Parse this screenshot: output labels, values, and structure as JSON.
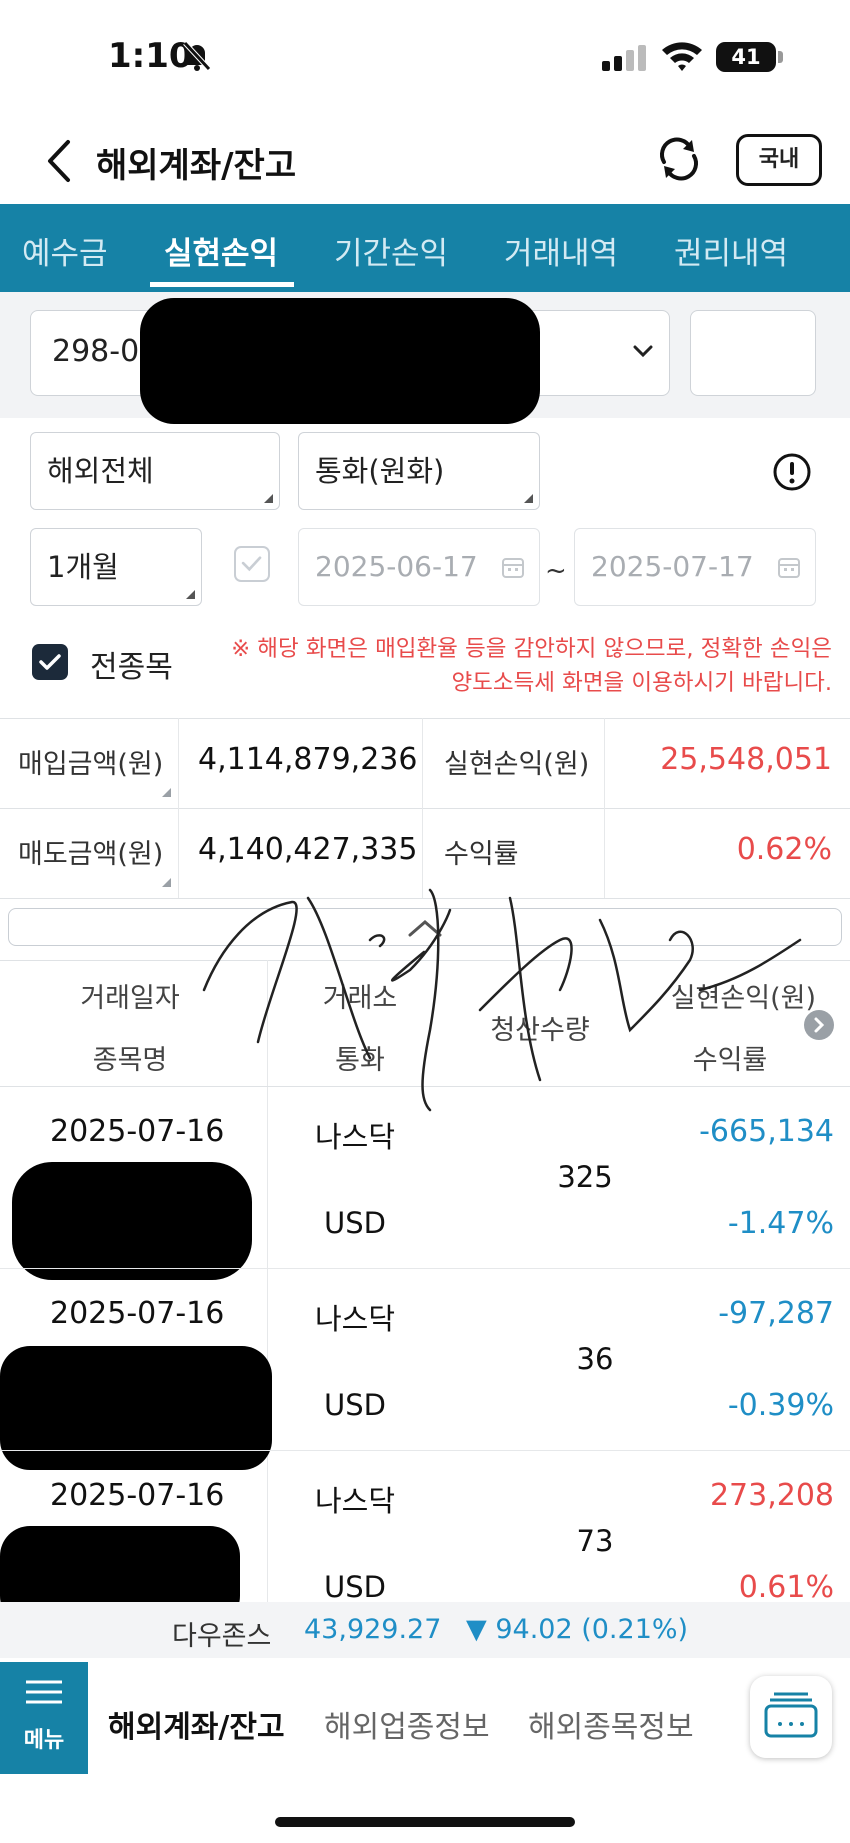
{
  "status": {
    "time": "1:10",
    "battery": "41"
  },
  "header": {
    "title": "해외계좌/잔고",
    "domestic_label": "국내"
  },
  "tabs": [
    "예수금",
    "실현손익",
    "기간손익",
    "거래내역",
    "권리내역"
  ],
  "account": {
    "number_prefix": "298-0"
  },
  "filters": {
    "market": "해외전체",
    "currency": "통화(원화)",
    "period": "1개월",
    "start_date": "2025-06-17",
    "end_date": "2025-07-17",
    "tilde": "~",
    "all_items_label": "전종목",
    "notice": "※ 해당 화면은 매입환율 등을 감안하지 않으므로, 정확한 손익은 양도소득세 화면을 이용하시기 바랍니다."
  },
  "summary": {
    "buy_label": "매입금액(원)",
    "buy_value": "4,114,879,236",
    "sell_label": "매도금액(원)",
    "sell_value": "4,140,427,335",
    "pnl_label": "실현손익(원)",
    "pnl_value": "25,548,051",
    "rate_label": "수익률",
    "rate_value": "0.62%"
  },
  "list_header": {
    "date": "거래일자",
    "name": "종목명",
    "exchange": "거래소",
    "currency": "통화",
    "qty": "청산수량",
    "pnl": "실현손익(원)",
    "rate": "수익률"
  },
  "rows": [
    {
      "date": "2025-07-16",
      "exchange": "나스닥",
      "currency": "USD",
      "qty": "325",
      "pnl": "-665,134",
      "rate": "-1.47%"
    },
    {
      "date": "2025-07-16",
      "exchange": "나스닥",
      "currency": "USD",
      "qty": "36",
      "pnl": "-97,287",
      "rate": "-0.39%"
    },
    {
      "date": "2025-07-16",
      "exchange": "나스닥",
      "currency": "USD",
      "qty": "73",
      "pnl": "273,208",
      "rate": "0.61%"
    }
  ],
  "ticker": {
    "name": "다우존스",
    "value": "43,929.27",
    "change": "▼ 94.02 (0.21%)"
  },
  "bottom_nav": {
    "menu": "메뉴",
    "items": [
      "해외계좌/잔고",
      "해외업종정보",
      "해외종목정보"
    ]
  },
  "colors": {
    "primary": "#1682a6",
    "loss": "#1f8ec6",
    "profit": "#e84b4b"
  }
}
